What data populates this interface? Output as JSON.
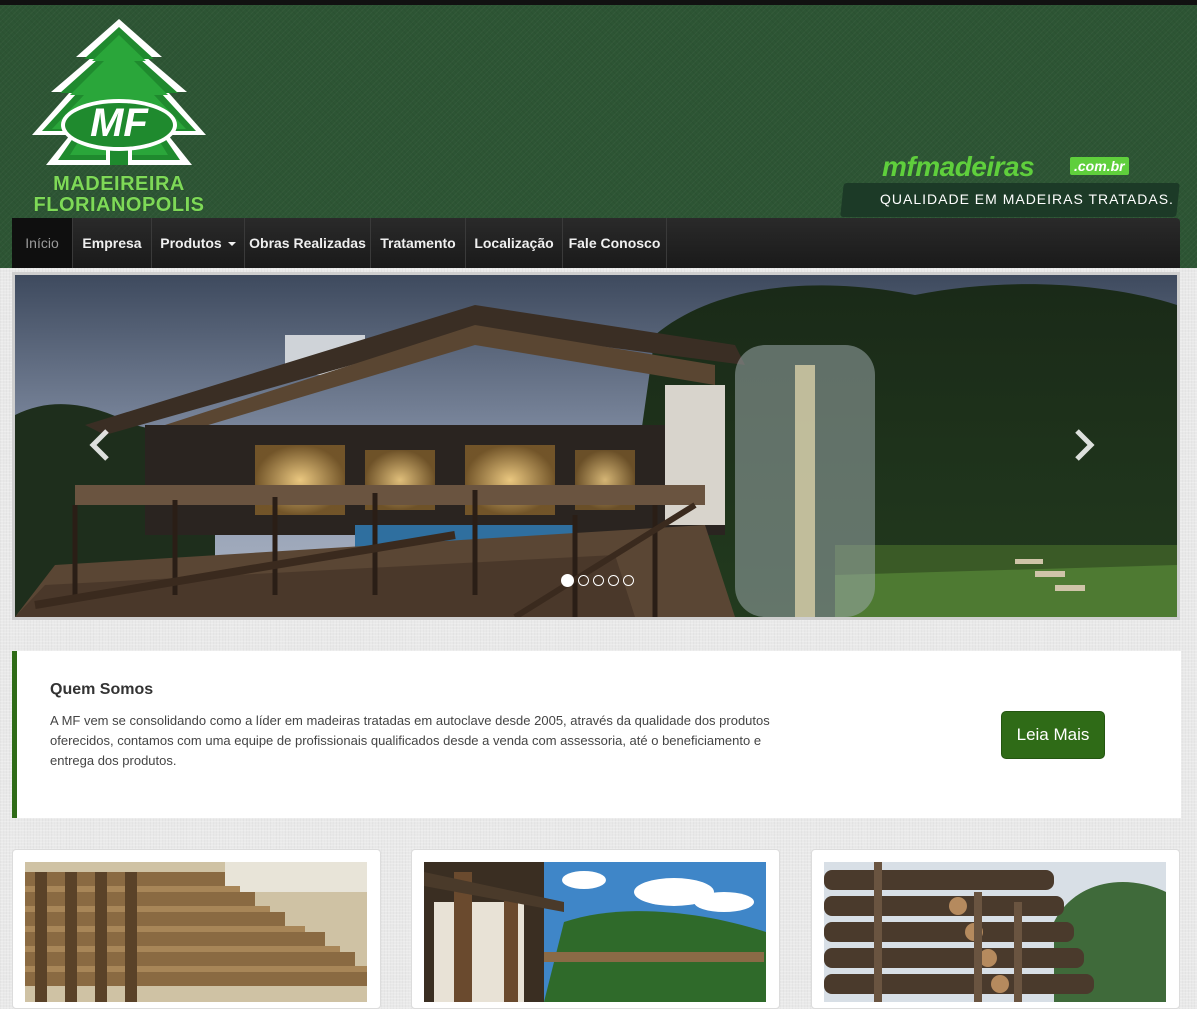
{
  "logo": {
    "initials": "MF",
    "line1": "MADEIREIRA",
    "line2": "FLORIANOPOLIS"
  },
  "brand": {
    "url": "mfmadeiras",
    "domain": ".com.br",
    "slogan": "QUALIDADE EM MADEIRAS TRATADAS."
  },
  "nav": {
    "items": [
      {
        "label": "Início",
        "active": true
      },
      {
        "label": "Empresa"
      },
      {
        "label": "Produtos",
        "dropdown": true
      },
      {
        "label": "Obras Realizadas"
      },
      {
        "label": "Tratamento"
      },
      {
        "label": "Localização"
      },
      {
        "label": "Fale Conosco"
      }
    ]
  },
  "carousel": {
    "slide_count": 5,
    "active_index": 0,
    "prev_icon": "chevron-left-icon",
    "next_icon": "chevron-right-icon"
  },
  "about": {
    "title": "Quem Somos",
    "text": "A MF vem se consolidando como a líder em madeiras tratadas em autoclave desde 2005, através da qualidade dos produtos oferecidos, contamos com uma equipe de profissionais qualificados desde a venda com assessoria, até o beneficiamento e entrega dos produtos.",
    "button_label": "Leia Mais"
  },
  "colors": {
    "header_green": "#2d5534",
    "accent_green": "#2f6b17",
    "brand_light_green": "#5fcf3c",
    "nav_dark": "#1a1a1a"
  }
}
